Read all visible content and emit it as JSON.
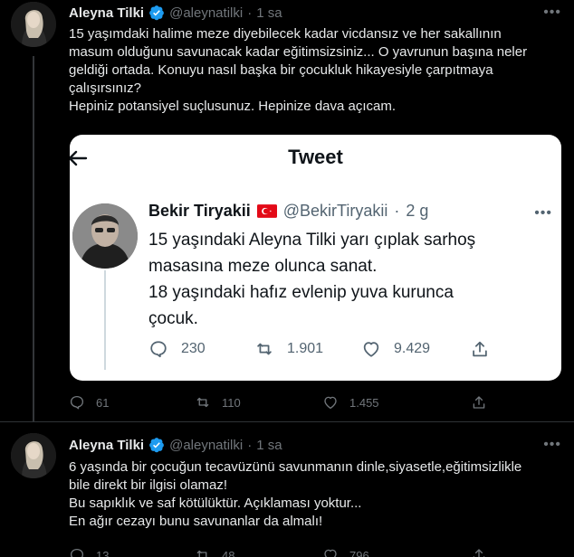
{
  "tweets": [
    {
      "author": {
        "name": "Aleyna Tilki",
        "handle": "@aleynatilki",
        "separator": "·",
        "time": "1 sa"
      },
      "text": "15 yaşımdaki halime meze diyebilecek kadar vicdansız ve her sakallının\nmasum olduğunu savunacak kadar eğitimsizsiniz... O yavrunun başına neler\ngeldiği ortada. Konuyu nasıl başka bir çocukluk hikayesiyle çarpıtmaya\nçalışırsınız?\nHepiniz potansiyel suçlusunuz. Hepinize dava açıcam.",
      "quoted_screenshot": {
        "title": "Tweet",
        "author": {
          "name": "Bekir Tiryakii",
          "handle": "@BekirTiryakii",
          "separator": "·",
          "time": "2 g"
        },
        "text": "15 yaşındaki Aleyna Tilki yarı çıplak sarhoş\nmasasına meze olunca sanat.\n18 yaşındaki hafız evlenip yuva kurunca\nçocuk.",
        "stats": {
          "replies": "230",
          "retweets": "1.901",
          "likes": "9.429"
        }
      },
      "stats": {
        "replies": "61",
        "retweets": "110",
        "likes": "1.455"
      }
    },
    {
      "author": {
        "name": "Aleyna Tilki",
        "handle": "@aleynatilki",
        "separator": "·",
        "time": "1 sa"
      },
      "text": "6 yaşında bir çocuğun tecavüzünü savunmanın dinle,siyasetle,eğitimsizlikle\nbile direkt bir ilgisi olamaz!\nBu sapıklık ve saf kötülüktür. Açıklaması yoktur...\nEn ağır cezayı bunu savunanlar da almalı!",
      "stats": {
        "replies": "13",
        "retweets": "48",
        "likes": "796"
      }
    }
  ],
  "icons": {
    "verified": "verified-badge-icon",
    "reply": "reply-icon",
    "retweet": "retweet-icon",
    "like": "heart-icon",
    "share": "share-icon",
    "more": "more-icon",
    "back": "back-arrow-icon",
    "flag": "turkey-flag-icon"
  },
  "colors": {
    "background": "#000000",
    "text": "#e7e9ea",
    "secondary": "#71767b",
    "verified": "#1d9bf0",
    "card_background": "#ffffff",
    "flag_red": "#e30a17"
  }
}
